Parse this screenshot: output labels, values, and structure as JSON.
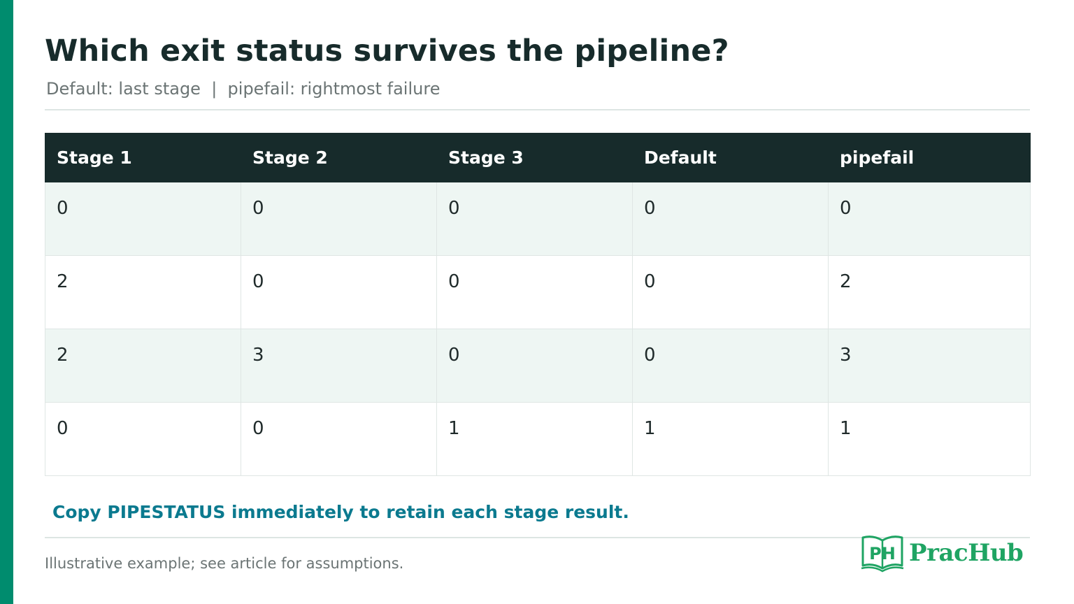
{
  "title": "Which exit status survives the pipeline?",
  "subtitle": "Default: last stage  |  pipefail: rightmost failure",
  "table": {
    "headers": [
      "Stage 1",
      "Stage 2",
      "Stage 3",
      "Default",
      "pipefail"
    ],
    "rows": [
      [
        "0",
        "0",
        "0",
        "0",
        "0"
      ],
      [
        "2",
        "0",
        "0",
        "0",
        "2"
      ],
      [
        "2",
        "3",
        "0",
        "0",
        "3"
      ],
      [
        "0",
        "0",
        "1",
        "1",
        "1"
      ]
    ]
  },
  "callout": "Copy PIPESTATUS immediately to retain each stage result.",
  "footnote": "Illustrative example; see article for assumptions.",
  "logo": {
    "mark_text": "PH",
    "name": "PracHub",
    "icon": "open-book-icon"
  },
  "colors": {
    "accent_bar": "#008c6e",
    "header_bg": "#172b2b",
    "row_alt_bg": "#eef6f3",
    "callout": "#0b7a8f",
    "logo": "#1fa463"
  }
}
